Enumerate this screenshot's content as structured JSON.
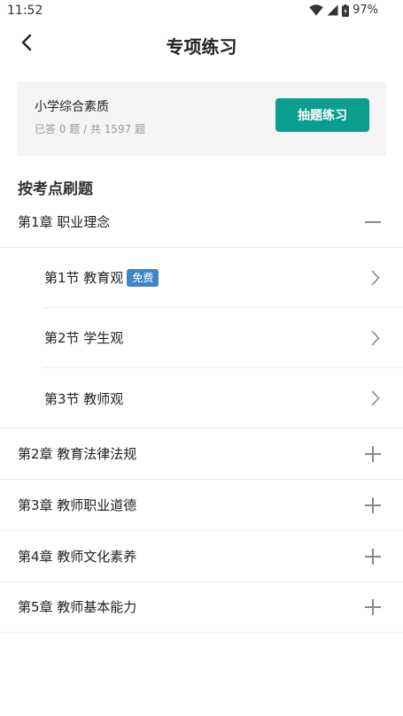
{
  "status_bar": {
    "time": "11:52",
    "battery": "97%"
  },
  "nav": {
    "title": "专项练习",
    "back_icon": "back-arrow-icon"
  },
  "card": {
    "title": "小学综合素质",
    "progress": "已答 0 题 / 共 1597 题",
    "button": "抽题练习"
  },
  "section_title": "按考点刷题",
  "chapters": [
    {
      "label": "第1章 职业理念",
      "expanded": true
    },
    {
      "label": "第2章 教育法律法规",
      "expanded": false
    },
    {
      "label": "第3章 教师职业道德",
      "expanded": false
    },
    {
      "label": "第4章 教师文化素养",
      "expanded": false
    },
    {
      "label": "第5章 教师基本能力",
      "expanded": false
    }
  ],
  "sections": [
    {
      "label": "第1节 教育观",
      "badge": "免费"
    },
    {
      "label": "第2节 学生观"
    },
    {
      "label": "第3节 教师观"
    }
  ],
  "colors": {
    "accent": "#0a9e8f",
    "badge": "#3d86c6"
  }
}
